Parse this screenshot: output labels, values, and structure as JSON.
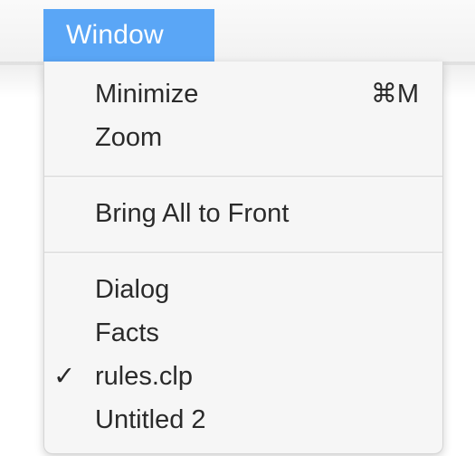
{
  "menubar": {
    "active_menu": "Window"
  },
  "menu": {
    "groups": [
      [
        {
          "label": "Minimize",
          "shortcut": "⌘M"
        },
        {
          "label": "Zoom"
        }
      ],
      [
        {
          "label": "Bring All to Front"
        }
      ],
      [
        {
          "label": "Dialog"
        },
        {
          "label": "Facts"
        },
        {
          "label": "rules.clp",
          "checked": true,
          "check_mark": "✓"
        },
        {
          "label": "Untitled 2"
        }
      ]
    ]
  }
}
